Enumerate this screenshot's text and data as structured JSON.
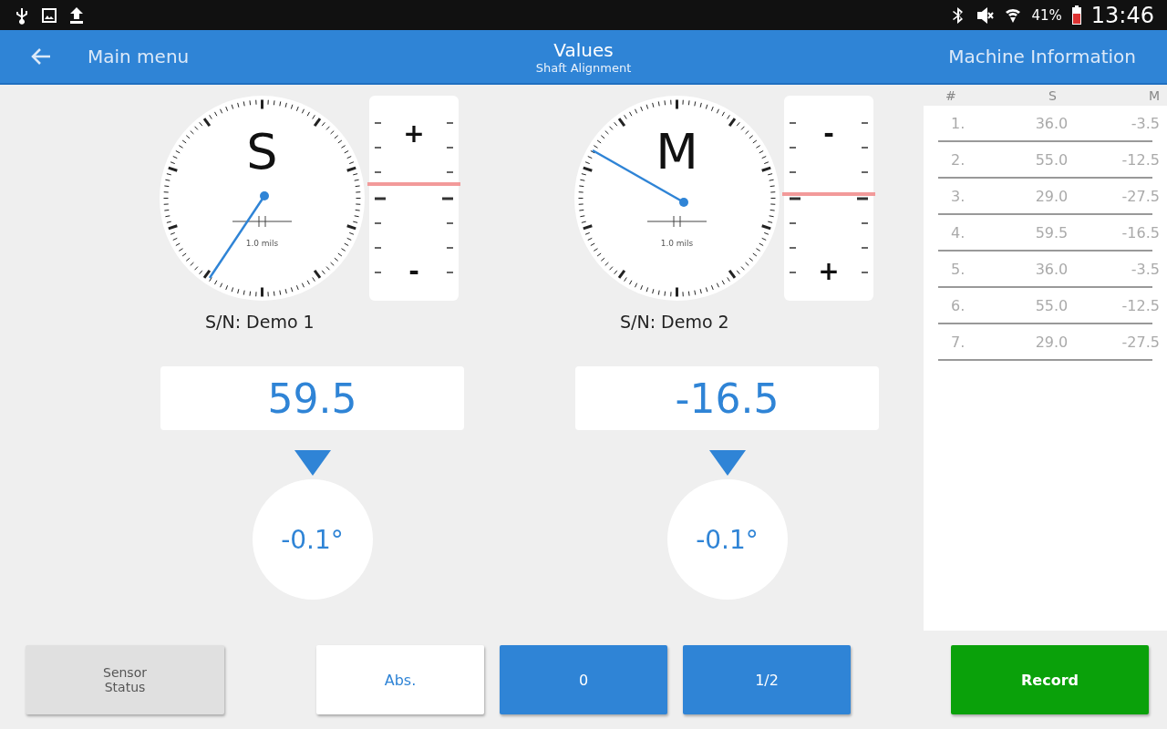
{
  "status_bar": {
    "battery": "41%",
    "time": "13:46"
  },
  "app_bar": {
    "back_label": "Main menu",
    "title": "Values",
    "subtitle": "Shaft Alignment",
    "action": "Machine Information"
  },
  "sensors": [
    {
      "letter": "S",
      "unit": "1.0 mils",
      "scale_top": "+",
      "scale_bottom": "-",
      "serial": "S/N: Demo 1",
      "value": "59.5",
      "angle": "-0.1°"
    },
    {
      "letter": "M",
      "unit": "1.0 mils",
      "scale_top": "-",
      "scale_bottom": "+",
      "serial": "S/N: Demo 2",
      "value": "-16.5",
      "angle": "-0.1°"
    }
  ],
  "table": {
    "columns": [
      "#",
      "S",
      "M"
    ],
    "rows": [
      [
        "1.",
        "36.0",
        "-3.5"
      ],
      [
        "2.",
        "55.0",
        "-12.5"
      ],
      [
        "3.",
        "29.0",
        "-27.5"
      ],
      [
        "4.",
        "59.5",
        "-16.5"
      ],
      [
        "5.",
        "36.0",
        "-3.5"
      ],
      [
        "6.",
        "55.0",
        "-12.5"
      ],
      [
        "7.",
        "29.0",
        "-27.5"
      ]
    ]
  },
  "buttons": {
    "sensor_status": "Sensor\nStatus",
    "modes": [
      {
        "label": "Abs.",
        "selected": true
      },
      {
        "label": "0",
        "selected": false
      },
      {
        "label": "1/2",
        "selected": false
      }
    ],
    "record": "Record"
  }
}
